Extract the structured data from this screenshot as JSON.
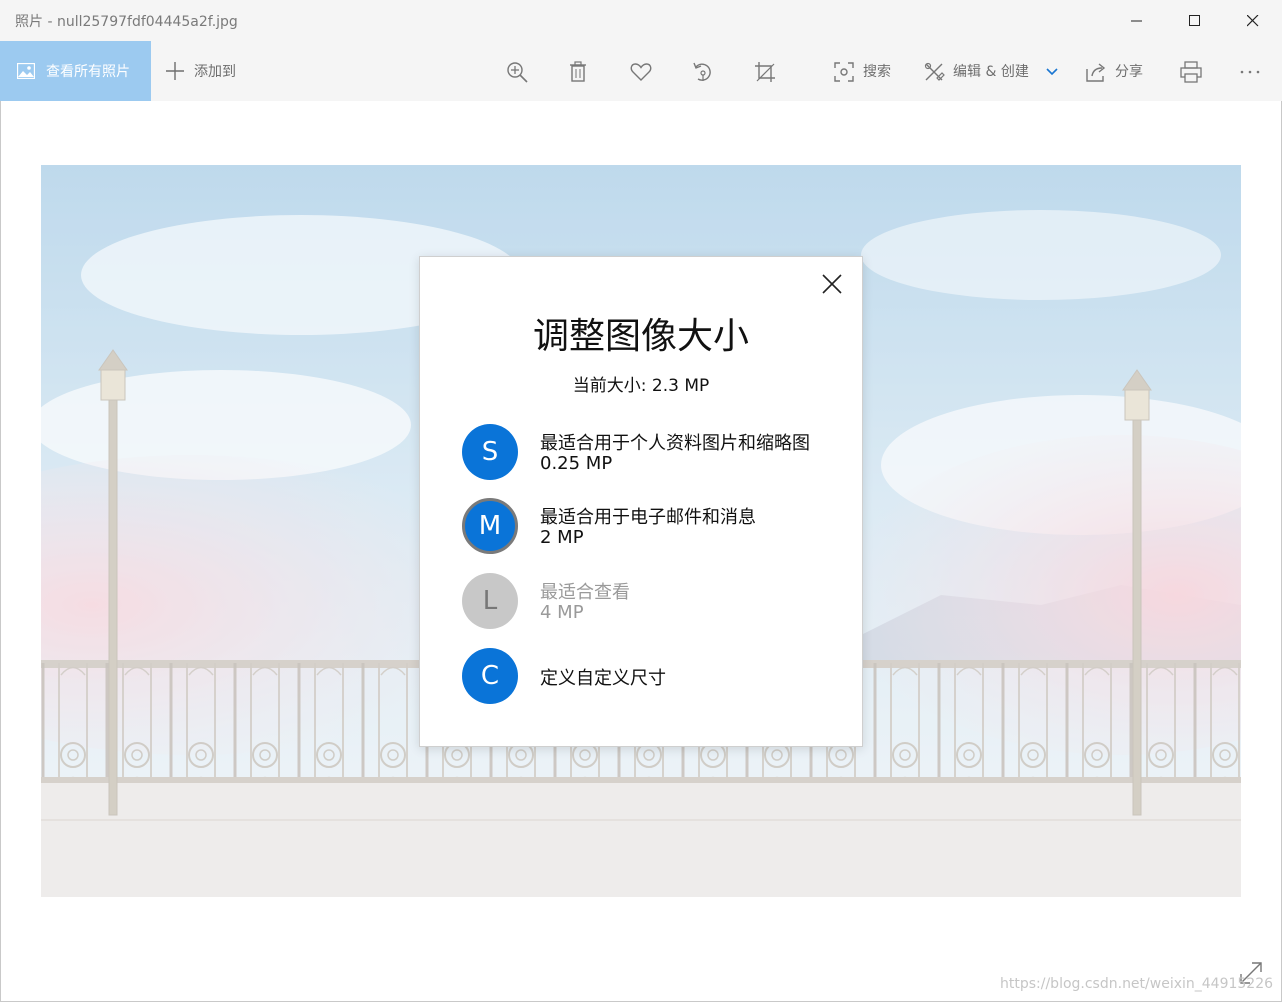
{
  "window": {
    "title": "照片 - null25797fdf04445a2f.jpg"
  },
  "toolbar": {
    "view_all_label": "查看所有照片",
    "add_to_label": "添加到",
    "search_label": "搜索",
    "edit_create_label": "编辑 & 创建",
    "share_label": "分享"
  },
  "dialog": {
    "title": "调整图像大小",
    "current_size": "当前大小: 2.3 MP",
    "options": [
      {
        "letter": "S",
        "title": "最适合用于个人资料图片和缩略图",
        "size": "0.25 MP",
        "state": "normal"
      },
      {
        "letter": "M",
        "title": "最适合用于电子邮件和消息",
        "size": "2 MP",
        "state": "selected"
      },
      {
        "letter": "L",
        "title": "最适合查看",
        "size": "4 MP",
        "state": "disabled"
      },
      {
        "letter": "C",
        "title": "定义自定义尺寸",
        "size": "",
        "state": "normal"
      }
    ]
  },
  "watermark": "https://blog.csdn.net/weixin_44915226",
  "colors": {
    "accent": "#0a74d8",
    "view_all_bg": "#9ccaf0",
    "disabled": "#c8c8c8"
  }
}
